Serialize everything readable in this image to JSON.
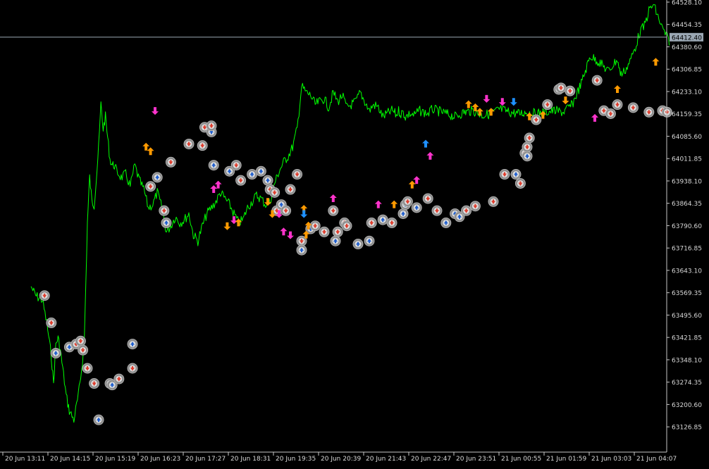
{
  "colors": {
    "background": "#000000",
    "price_line": "#00ff00",
    "axis": "#c8c8c8",
    "axis_text": "#d8d8d8",
    "current_price_line": "#9aa7b3",
    "current_price_tag_bg": "#9aa7b3",
    "marker_circle": "#8a8a8a",
    "buy_marker": "#1f5fd0",
    "sell_marker": "#e03c2c",
    "arrow_orange": "#ff9a00",
    "arrow_magenta": "#ff33cc",
    "arrow_blue": "#1e90ff"
  },
  "chart_data": {
    "type": "line",
    "grid": false,
    "legend": "none",
    "ylim": [
      63090,
      64528.1
    ],
    "y_ticks": [
      "64528.10",
      "64454.35",
      "64380.60",
      "64306.85",
      "64233.10",
      "64159.35",
      "64085.60",
      "64011.85",
      "63938.10",
      "63864.35",
      "63790.60",
      "63716.85",
      "63643.10",
      "63569.35",
      "63495.60",
      "63421.85",
      "63348.10",
      "63274.35",
      "63200.60",
      "63126.85"
    ],
    "y_tick_values": [
      64528.1,
      64454.35,
      64380.6,
      64306.85,
      64233.1,
      64159.35,
      64085.6,
      64011.85,
      63938.1,
      63864.35,
      63790.6,
      63716.85,
      63643.1,
      63569.35,
      63495.6,
      63421.85,
      63348.1,
      63274.35,
      63200.6,
      63126.85
    ],
    "x_ticks": [
      "20 Jun 13:11",
      "20 Jun 14:15",
      "20 Jun 15:19",
      "20 Jun 16:23",
      "20 Jun 17:27",
      "20 Jun 18:31",
      "20 Jun 19:35",
      "20 Jun 20:39",
      "20 Jun 21:43",
      "20 Jun 22:47",
      "20 Jun 23:51",
      "21 Jun 00:55",
      "21 Jun 01:59",
      "21 Jun 03:03",
      "21 Jun 04:07"
    ],
    "current_price": 64412.4,
    "current_price_label": "64412.40",
    "series": [
      {
        "x": [
          0,
          0.1,
          0.25,
          0.35,
          0.45,
          0.5,
          0.55,
          0.6,
          0.65,
          0.72,
          0.78,
          0.85,
          0.95,
          1.05,
          1.1,
          1.18,
          1.25,
          1.3,
          1.35,
          1.4,
          1.45,
          1.5,
          1.55,
          1.6,
          1.65,
          1.7,
          1.75,
          1.8,
          1.85,
          1.9,
          2.0,
          2.1,
          2.2,
          2.3,
          2.4,
          2.5,
          2.6,
          2.7,
          2.8,
          2.9,
          3.0,
          3.1,
          3.2,
          3.3,
          3.4,
          3.5,
          3.6,
          3.7,
          3.8,
          3.9,
          4.0,
          4.1,
          4.2,
          4.3,
          4.4,
          4.5,
          4.6,
          4.7,
          4.8,
          4.9,
          5.0,
          5.1,
          5.2,
          5.3,
          5.4,
          5.5,
          5.6,
          5.7,
          5.8,
          5.9,
          6.0,
          6.1,
          6.2,
          6.3,
          6.4,
          6.5,
          6.6,
          6.7,
          6.8,
          6.9,
          7.0,
          7.1,
          7.2,
          7.3,
          7.4,
          7.5,
          7.6,
          7.7,
          7.8,
          7.9,
          8.0,
          8.05,
          8.1,
          8.15,
          8.2,
          8.25,
          8.3,
          8.4,
          8.5,
          8.6,
          8.7,
          8.8,
          8.9,
          9.0,
          9.2,
          9.4,
          9.6,
          9.8,
          10.0,
          10.2,
          10.4,
          10.6,
          10.8,
          11.0,
          11.2,
          11.4,
          11.6,
          11.8,
          12.0,
          12.2,
          12.4,
          12.6,
          12.8,
          12.9,
          13.0,
          13.05,
          13.1,
          13.2,
          13.3,
          13.4,
          13.5,
          13.6,
          13.7,
          13.8,
          13.9,
          14.0,
          14.1,
          14.15
        ],
        "values": [
          63590,
          63560,
          63545,
          63470,
          63360,
          63270,
          63400,
          63420,
          63380,
          63300,
          63230,
          63180,
          63150,
          63230,
          63290,
          63400,
          63800,
          63950,
          63870,
          63860,
          63950,
          64050,
          64190,
          64110,
          64150,
          64080,
          64010,
          63990,
          63990,
          63970,
          63950,
          63960,
          63920,
          63990,
          63940,
          63910,
          63850,
          63860,
          63900,
          63850,
          63770,
          63790,
          63820,
          63800,
          63810,
          63830,
          63760,
          63740,
          63790,
          63830,
          63850,
          63870,
          63900,
          63880,
          63860,
          63830,
          63800,
          63810,
          63850,
          63870,
          63890,
          63880,
          63860,
          63870,
          63930,
          63970,
          64000,
          64020,
          64050,
          64110,
          64250,
          64230,
          64220,
          64190,
          64200,
          64210,
          64180,
          64230,
          64200,
          64220,
          64180,
          64190,
          64200,
          64230,
          64200,
          64170,
          64190,
          64180,
          64150,
          64160,
          64170,
          64165,
          64155,
          64170,
          64160,
          64165,
          64150,
          64160,
          64155,
          64170,
          64165,
          64160,
          64175,
          64170,
          64160,
          64150,
          64165,
          64170,
          64155,
          64160,
          64175,
          64165,
          64160,
          64165,
          64160,
          64165,
          64170,
          64165,
          64190,
          64260,
          64350,
          64330,
          64300,
          64320,
          64340,
          64300,
          64290,
          64310,
          64340,
          64380,
          64430,
          64450,
          64500,
          64520,
          64480,
          64440,
          64412.4,
          64400
        ]
      }
    ],
    "markers": [
      {
        "x": 0.3,
        "y": 63560,
        "kind": "sell"
      },
      {
        "x": 0.45,
        "y": 63470,
        "kind": "sell"
      },
      {
        "x": 0.55,
        "y": 63370,
        "kind": "buy"
      },
      {
        "x": 0.85,
        "y": 63390,
        "kind": "buy"
      },
      {
        "x": 1.0,
        "y": 63400,
        "kind": "sell"
      },
      {
        "x": 1.1,
        "y": 63410,
        "kind": "sell"
      },
      {
        "x": 1.15,
        "y": 63380,
        "kind": "sell"
      },
      {
        "x": 1.25,
        "y": 63320,
        "kind": "sell"
      },
      {
        "x": 1.4,
        "y": 63270,
        "kind": "sell"
      },
      {
        "x": 1.75,
        "y": 63270,
        "kind": "sell"
      },
      {
        "x": 1.8,
        "y": 63265,
        "kind": "buy"
      },
      {
        "x": 1.95,
        "y": 63285,
        "kind": "sell"
      },
      {
        "x": 1.5,
        "y": 63150,
        "kind": "buy"
      },
      {
        "x": 2.25,
        "y": 63400,
        "kind": "buy"
      },
      {
        "x": 2.25,
        "y": 63320,
        "kind": "sell"
      },
      {
        "x": 2.65,
        "y": 63920,
        "kind": "sell"
      },
      {
        "x": 2.8,
        "y": 63950,
        "kind": "buy"
      },
      {
        "x": 2.95,
        "y": 63840,
        "kind": "sell"
      },
      {
        "x": 3.0,
        "y": 63800,
        "kind": "buy"
      },
      {
        "x": 3.1,
        "y": 64000,
        "kind": "sell"
      },
      {
        "x": 3.5,
        "y": 64060,
        "kind": "sell"
      },
      {
        "x": 3.85,
        "y": 64115,
        "kind": "sell"
      },
      {
        "x": 4.0,
        "y": 64100,
        "kind": "buy"
      },
      {
        "x": 4.0,
        "y": 64120,
        "kind": "sell"
      },
      {
        "x": 3.8,
        "y": 64055,
        "kind": "sell"
      },
      {
        "x": 4.05,
        "y": 63990,
        "kind": "buy"
      },
      {
        "x": 4.4,
        "y": 63970,
        "kind": "buy"
      },
      {
        "x": 4.55,
        "y": 63990,
        "kind": "sell"
      },
      {
        "x": 4.65,
        "y": 63940,
        "kind": "sell"
      },
      {
        "x": 4.9,
        "y": 63960,
        "kind": "buy"
      },
      {
        "x": 5.1,
        "y": 63970,
        "kind": "buy"
      },
      {
        "x": 5.3,
        "y": 63910,
        "kind": "sell"
      },
      {
        "x": 5.4,
        "y": 63900,
        "kind": "sell"
      },
      {
        "x": 5.45,
        "y": 63840,
        "kind": "sell"
      },
      {
        "x": 5.55,
        "y": 63860,
        "kind": "buy"
      },
      {
        "x": 5.65,
        "y": 63840,
        "kind": "sell"
      },
      {
        "x": 5.75,
        "y": 63910,
        "kind": "sell"
      },
      {
        "x": 5.9,
        "y": 63960,
        "kind": "sell"
      },
      {
        "x": 5.25,
        "y": 63940,
        "kind": "buy"
      },
      {
        "x": 6.0,
        "y": 63740,
        "kind": "sell"
      },
      {
        "x": 6.0,
        "y": 63710,
        "kind": "buy"
      },
      {
        "x": 6.2,
        "y": 63780,
        "kind": "buy"
      },
      {
        "x": 6.3,
        "y": 63790,
        "kind": "sell"
      },
      {
        "x": 6.5,
        "y": 63770,
        "kind": "sell"
      },
      {
        "x": 6.7,
        "y": 63840,
        "kind": "sell"
      },
      {
        "x": 6.8,
        "y": 63770,
        "kind": "sell"
      },
      {
        "x": 6.95,
        "y": 63800,
        "kind": "sell"
      },
      {
        "x": 7.0,
        "y": 63790,
        "kind": "sell"
      },
      {
        "x": 6.75,
        "y": 63740,
        "kind": "buy"
      },
      {
        "x": 7.25,
        "y": 63730,
        "kind": "buy"
      },
      {
        "x": 7.5,
        "y": 63740,
        "kind": "buy"
      },
      {
        "x": 7.55,
        "y": 63800,
        "kind": "sell"
      },
      {
        "x": 7.8,
        "y": 63810,
        "kind": "buy"
      },
      {
        "x": 8.0,
        "y": 63800,
        "kind": "sell"
      },
      {
        "x": 8.25,
        "y": 63830,
        "kind": "buy"
      },
      {
        "x": 8.3,
        "y": 63860,
        "kind": "buy"
      },
      {
        "x": 8.35,
        "y": 63870,
        "kind": "sell"
      },
      {
        "x": 8.55,
        "y": 63850,
        "kind": "buy"
      },
      {
        "x": 8.8,
        "y": 63880,
        "kind": "sell"
      },
      {
        "x": 9.0,
        "y": 63840,
        "kind": "sell"
      },
      {
        "x": 9.2,
        "y": 63800,
        "kind": "buy"
      },
      {
        "x": 9.4,
        "y": 63830,
        "kind": "buy"
      },
      {
        "x": 9.5,
        "y": 63820,
        "kind": "buy"
      },
      {
        "x": 9.65,
        "y": 63840,
        "kind": "sell"
      },
      {
        "x": 9.85,
        "y": 63855,
        "kind": "sell"
      },
      {
        "x": 10.25,
        "y": 63870,
        "kind": "sell"
      },
      {
        "x": 10.5,
        "y": 63960,
        "kind": "sell"
      },
      {
        "x": 10.75,
        "y": 63960,
        "kind": "buy"
      },
      {
        "x": 10.85,
        "y": 63930,
        "kind": "sell"
      },
      {
        "x": 10.95,
        "y": 64030,
        "kind": "sell"
      },
      {
        "x": 11.0,
        "y": 64020,
        "kind": "buy"
      },
      {
        "x": 11.0,
        "y": 64050,
        "kind": "sell"
      },
      {
        "x": 11.05,
        "y": 64080,
        "kind": "sell"
      },
      {
        "x": 11.2,
        "y": 64140,
        "kind": "sell"
      },
      {
        "x": 11.45,
        "y": 64190,
        "kind": "sell"
      },
      {
        "x": 11.7,
        "y": 64240,
        "kind": "buy"
      },
      {
        "x": 11.75,
        "y": 64245,
        "kind": "sell"
      },
      {
        "x": 11.95,
        "y": 64235,
        "kind": "sell"
      },
      {
        "x": 12.55,
        "y": 64270,
        "kind": "sell"
      },
      {
        "x": 12.7,
        "y": 64170,
        "kind": "sell"
      },
      {
        "x": 12.85,
        "y": 64160,
        "kind": "sell"
      },
      {
        "x": 13.0,
        "y": 64190,
        "kind": "sell"
      },
      {
        "x": 13.35,
        "y": 64180,
        "kind": "sell"
      },
      {
        "x": 13.7,
        "y": 64165,
        "kind": "sell"
      },
      {
        "x": 14.0,
        "y": 64170,
        "kind": "sell"
      },
      {
        "x": 14.1,
        "y": 64165,
        "kind": "sell"
      }
    ],
    "arrows": [
      {
        "x": 2.75,
        "y": 64170,
        "dir": "down",
        "color": "magenta"
      },
      {
        "x": 2.55,
        "y": 64050,
        "dir": "up",
        "color": "orange"
      },
      {
        "x": 2.65,
        "y": 64035,
        "dir": "up",
        "color": "orange"
      },
      {
        "x": 4.05,
        "y": 63910,
        "dir": "up",
        "color": "magenta"
      },
      {
        "x": 4.15,
        "y": 63925,
        "dir": "up",
        "color": "magenta"
      },
      {
        "x": 4.35,
        "y": 63790,
        "dir": "down",
        "color": "orange"
      },
      {
        "x": 4.5,
        "y": 63810,
        "dir": "down",
        "color": "magenta"
      },
      {
        "x": 4.6,
        "y": 63800,
        "dir": "up",
        "color": "orange"
      },
      {
        "x": 5.25,
        "y": 63870,
        "dir": "down",
        "color": "orange"
      },
      {
        "x": 5.35,
        "y": 63830,
        "dir": "down",
        "color": "orange"
      },
      {
        "x": 5.5,
        "y": 63830,
        "dir": "down",
        "color": "magenta"
      },
      {
        "x": 5.6,
        "y": 63770,
        "dir": "up",
        "color": "magenta"
      },
      {
        "x": 5.75,
        "y": 63760,
        "dir": "down",
        "color": "magenta"
      },
      {
        "x": 6.05,
        "y": 63845,
        "dir": "up",
        "color": "orange"
      },
      {
        "x": 6.15,
        "y": 63790,
        "dir": "up",
        "color": "orange"
      },
      {
        "x": 6.1,
        "y": 63760,
        "dir": "up",
        "color": "orange"
      },
      {
        "x": 6.05,
        "y": 63830,
        "dir": "down",
        "color": "blue"
      },
      {
        "x": 6.7,
        "y": 63880,
        "dir": "up",
        "color": "magenta"
      },
      {
        "x": 7.7,
        "y": 63860,
        "dir": "up",
        "color": "magenta"
      },
      {
        "x": 8.05,
        "y": 63860,
        "dir": "up",
        "color": "orange"
      },
      {
        "x": 8.45,
        "y": 63925,
        "dir": "up",
        "color": "orange"
      },
      {
        "x": 8.55,
        "y": 63940,
        "dir": "up",
        "color": "magenta"
      },
      {
        "x": 8.75,
        "y": 64060,
        "dir": "up",
        "color": "blue"
      },
      {
        "x": 8.85,
        "y": 64020,
        "dir": "up",
        "color": "magenta"
      },
      {
        "x": 9.7,
        "y": 64190,
        "dir": "up",
        "color": "orange"
      },
      {
        "x": 9.85,
        "y": 64180,
        "dir": "up",
        "color": "orange"
      },
      {
        "x": 9.95,
        "y": 64165,
        "dir": "up",
        "color": "orange"
      },
      {
        "x": 10.1,
        "y": 64210,
        "dir": "down",
        "color": "magenta"
      },
      {
        "x": 10.2,
        "y": 64165,
        "dir": "up",
        "color": "orange"
      },
      {
        "x": 10.45,
        "y": 64200,
        "dir": "down",
        "color": "magenta"
      },
      {
        "x": 10.7,
        "y": 64200,
        "dir": "down",
        "color": "blue"
      },
      {
        "x": 11.05,
        "y": 64150,
        "dir": "up",
        "color": "orange"
      },
      {
        "x": 11.35,
        "y": 64155,
        "dir": "up",
        "color": "orange"
      },
      {
        "x": 11.85,
        "y": 64205,
        "dir": "down",
        "color": "orange"
      },
      {
        "x": 12.5,
        "y": 64145,
        "dir": "up",
        "color": "magenta"
      },
      {
        "x": 13.0,
        "y": 64240,
        "dir": "up",
        "color": "orange"
      },
      {
        "x": 13.85,
        "y": 64330,
        "dir": "up",
        "color": "orange"
      }
    ]
  }
}
